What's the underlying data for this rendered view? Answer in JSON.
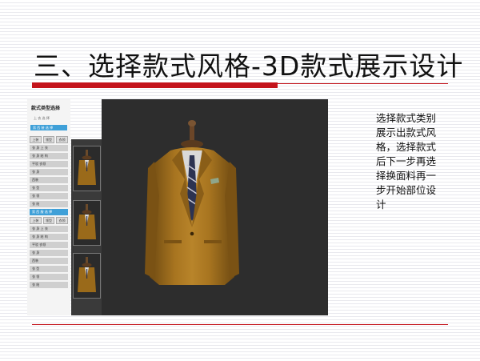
{
  "slide": {
    "title": "三、选择款式风格-3D款式展示设计",
    "description": "选择款式类别展示出款式风格，选择款式后下一步再选择换面料再一步开始部位设计"
  },
  "sidebar": {
    "title": "款式类型选择",
    "subtitle": "上 衣  选 择",
    "active_label": "男 西 装 选 择",
    "tabs": [
      "上装",
      "领型",
      "衣领"
    ],
    "items": [
      "衣 身  上 衣",
      "衣 身  结 构",
      "平驳 衣领",
      "衣 身",
      "西装",
      "衣 型",
      "衣 领",
      "衣 结"
    ],
    "active_label_2": "男 西 服 选 择",
    "tabs_2": [
      "上装",
      "领型",
      "衣领"
    ],
    "items_2": [
      "衣 身  上 衣",
      "衣 身  结 构",
      "平驳 衣领",
      "衣 身",
      "西装",
      "衣 型",
      "衣 领",
      "衣 结"
    ]
  },
  "colors": {
    "accent_red": "#c4141b",
    "viewer_bg": "#2d2d2d",
    "jacket": "#9a6a1a",
    "active_blue": "#3fa0d8"
  },
  "icons": {
    "mannequin": "suit-mannequin-icon",
    "thumbnail": "suit-thumbnail-icon"
  }
}
